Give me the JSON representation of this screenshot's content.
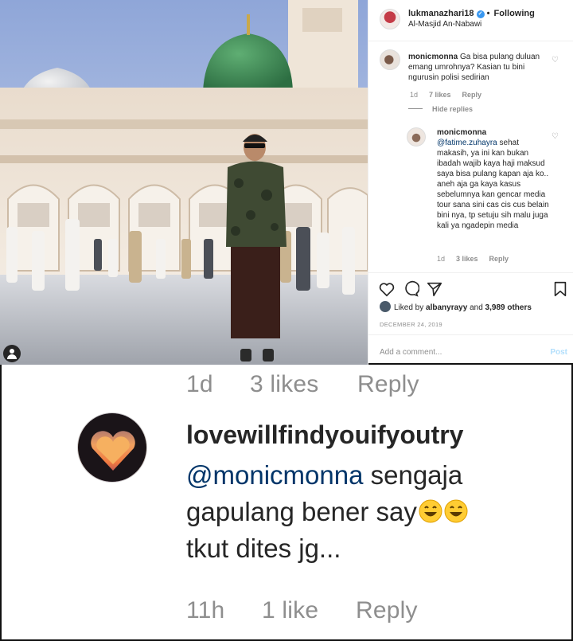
{
  "post": {
    "username": "lukmanazhari18",
    "follow_status": "Following",
    "location": "Al-Masjid An-Nabawi",
    "comments": [
      {
        "username": "monicmonna",
        "text": "Ga bisa pulang duluan emang umrohnya? Kasian tu bini ngurusin polisi sedirian",
        "age": "1d",
        "likes": "7 likes",
        "reply": "Reply"
      }
    ],
    "hide_replies": "Hide replies",
    "reply": {
      "username": "monicmonna",
      "mention": "@fatime.zuhayra",
      "text": "sehat makasih, ya ini kan bukan ibadah wajib kaya haji maksud saya bisa pulang kapan aja ko.. aneh aja ga kaya kasus sebelumnya kan gencar media tour sana sini cas cis cus belain bini nya, tp setuju sih malu juga kali ya ngadepin media",
      "age": "1d",
      "likes": "3 likes",
      "reply": "Reply"
    },
    "liked_by_prefix": "Liked by",
    "liked_by_user": "albanyrayy",
    "liked_by_suffix": "and",
    "liked_by_others": "3,989 others",
    "date": "DECEMBER 24, 2019",
    "add_comment_placeholder": "Add a comment...",
    "post_button": "Post"
  },
  "zoom": {
    "top_meta": {
      "age": "1d",
      "likes": "3 likes",
      "reply": "Reply"
    },
    "username": "lovewillfindyouifyoutry",
    "mention": "@monicmonna",
    "text_line1": "sengaja",
    "text_line2": "gapulang bener say",
    "text_line3": "tkut dites jg...",
    "bottom_meta": {
      "age": "11h",
      "likes": "1 like",
      "reply": "Reply"
    }
  },
  "icons": [
    "heart-icon",
    "comment-icon",
    "share-icon",
    "bookmark-icon",
    "verified-badge-icon",
    "user-tag-icon",
    "smiling-emoji-icon"
  ],
  "colors": {
    "link": "#003569",
    "meta_gray": "#8e8e8e",
    "verified_blue": "#3897f0",
    "post_button": "#b2dffc"
  }
}
